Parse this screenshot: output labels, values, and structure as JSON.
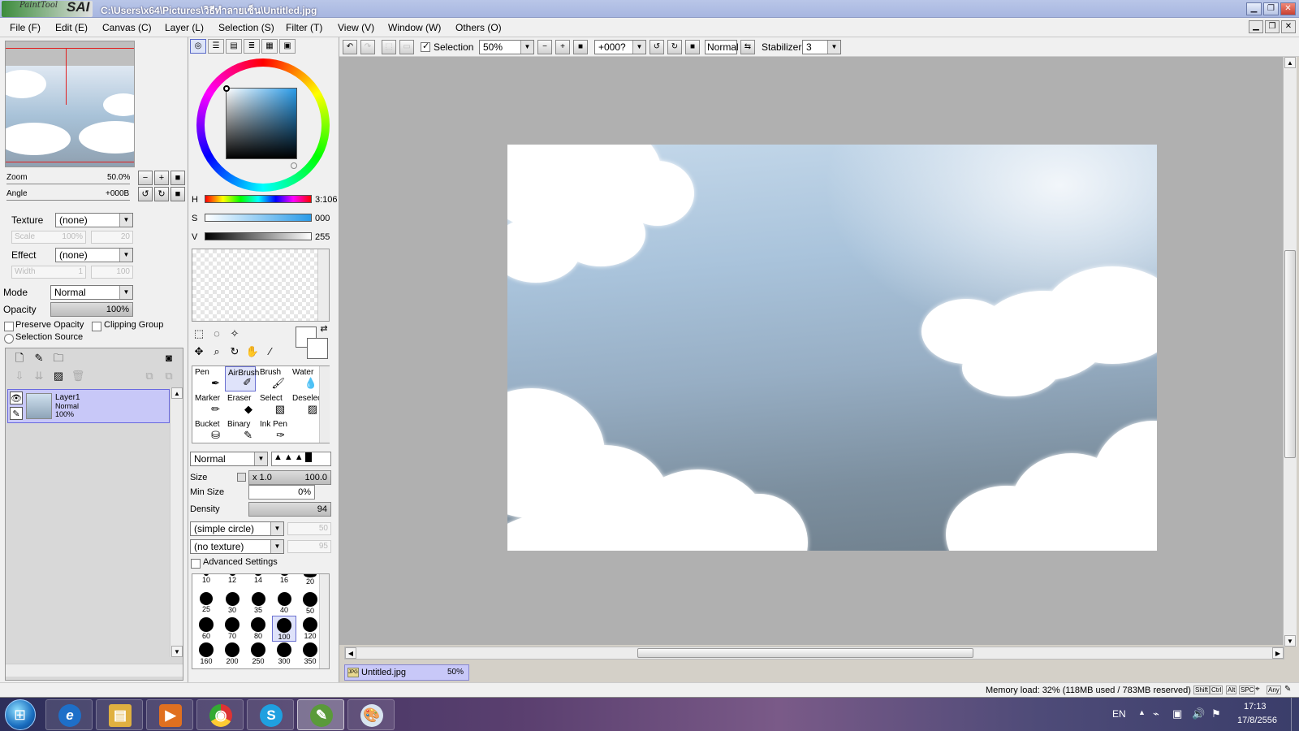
{
  "app": {
    "logo_small": "PaintTool",
    "logo_big": "SAI",
    "title": "C:\\Users\\x64\\Pictures\\วิธีทำลายเซ็น\\Untitled.jpg"
  },
  "menu": [
    {
      "label": "File (F)"
    },
    {
      "label": "Edit (E)"
    },
    {
      "label": "Canvas (C)"
    },
    {
      "label": "Layer (L)"
    },
    {
      "label": "Selection (S)"
    },
    {
      "label": "Filter (T)"
    },
    {
      "label": "View (V)"
    },
    {
      "label": "Window (W)"
    },
    {
      "label": "Others (O)"
    }
  ],
  "navigator": {
    "zoom_label": "Zoom",
    "zoom_value": "50.0%",
    "angle_label": "Angle",
    "angle_value": "+000B"
  },
  "brush_texture": {
    "texture_label": "Texture",
    "texture_value": "(none)",
    "scale_label": "Scale",
    "scale_value": "100%",
    "scale_num": "20",
    "effect_label": "Effect",
    "effect_value": "(none)",
    "width_label": "Width",
    "width_value": "1",
    "width_num": "100"
  },
  "layer_props": {
    "mode_label": "Mode",
    "mode_value": "Normal",
    "opacity_label": "Opacity",
    "opacity_value": "100%",
    "preserve_opacity": "Preserve Opacity",
    "clipping_group": "Clipping Group",
    "selection_source": "Selection Source"
  },
  "layers": [
    {
      "name": "Layer1",
      "mode": "Normal",
      "opacity": "100%"
    }
  ],
  "color": {
    "h_label": "H",
    "h_value": "3:106",
    "s_label": "S",
    "s_value": "000",
    "v_label": "V",
    "v_value": "255"
  },
  "tools": [
    {
      "label": "Pen",
      "icon": "pen-icon"
    },
    {
      "label": "AirBrush",
      "icon": "airbrush-icon",
      "active": true
    },
    {
      "label": "Brush",
      "icon": "brush-icon"
    },
    {
      "label": "Water",
      "icon": "water-icon"
    },
    {
      "label": "Marker",
      "icon": "marker-icon"
    },
    {
      "label": "Eraser",
      "icon": "eraser-icon"
    },
    {
      "label": "Select",
      "icon": "select-icon"
    },
    {
      "label": "Deselect",
      "icon": "deselect-icon"
    },
    {
      "label": "Bucket",
      "icon": "bucket-icon"
    },
    {
      "label": "Binary",
      "icon": "binary-icon"
    },
    {
      "label": "Ink Pen",
      "icon": "ink-pen-icon"
    }
  ],
  "brush": {
    "mode_value": "Normal",
    "size_label": "Size",
    "size_mult": "x 1.0",
    "size_value": "100.0",
    "minsize_label": "Min Size",
    "minsize_value": "0%",
    "density_label": "Density",
    "density_value": "94",
    "shape_value": "(simple circle)",
    "shape_num": "50",
    "texture_value": "(no texture)",
    "texture_num": "95",
    "advanced_label": "Advanced Settings"
  },
  "brush_sizes": [
    "10",
    "12",
    "14",
    "16",
    "20",
    "25",
    "30",
    "35",
    "40",
    "50",
    "60",
    "70",
    "80",
    "100",
    "120",
    "160",
    "200",
    "250",
    "300",
    "350"
  ],
  "toolbar": {
    "selection_label": "Selection",
    "zoom_value": "50%",
    "angle_value": "+000?",
    "blend_value": "Normal",
    "stabilizer_label": "Stabilizer",
    "stabilizer_value": "3"
  },
  "document_tab": {
    "name": "Untitled.jpg",
    "zoom": "50%"
  },
  "status": {
    "memory": "Memory load: 32% (118MB used / 783MB reserved)",
    "keys": [
      "Shift",
      "Ctrl",
      "Alt",
      "SPC",
      "Any"
    ]
  },
  "taskbar": {
    "apps": [
      {
        "name": "internet-explorer",
        "glyph": "e"
      },
      {
        "name": "file-explorer",
        "glyph": "▤"
      },
      {
        "name": "media-player",
        "glyph": "▶"
      },
      {
        "name": "chrome",
        "glyph": "◉"
      },
      {
        "name": "skype",
        "glyph": "S"
      },
      {
        "name": "painttool-sai",
        "glyph": "✎"
      },
      {
        "name": "paint",
        "glyph": "🎨"
      }
    ],
    "lang": "EN",
    "time": "17:13",
    "date": "17/8/2556"
  }
}
